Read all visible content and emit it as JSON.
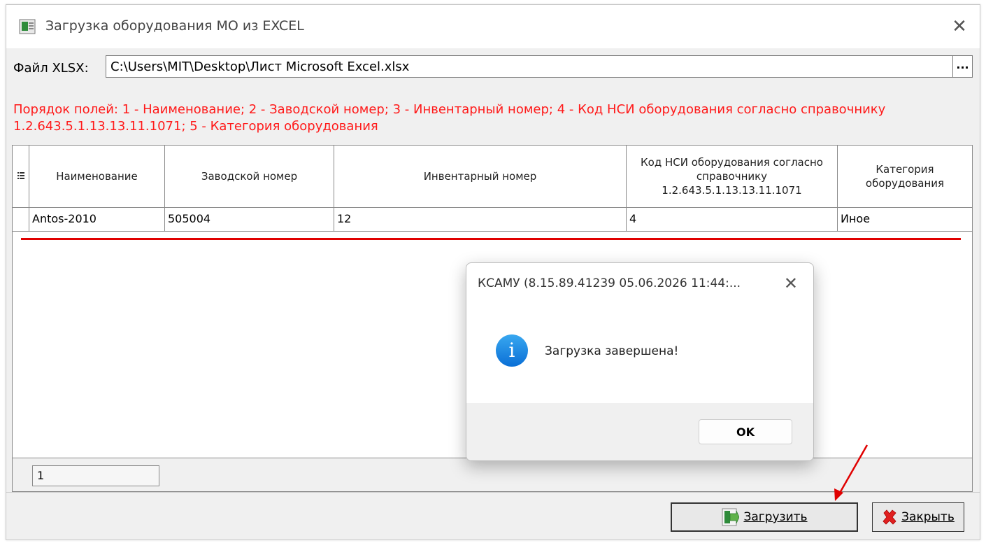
{
  "window": {
    "title": "Загрузка оборудования МО из EXCEL",
    "close_glyph": "✕"
  },
  "file": {
    "label": "Файл XLSX:",
    "value": "C:\\Users\\MIT\\Desktop\\Лист Microsoft Excel.xlsx",
    "browse_label": "..."
  },
  "order_note": "Порядок полей: 1 - Наименование; 2 - Заводской номер; 3 - Инвентарный номер; 4 - Код НСИ оборудования согласно справочнику 1.2.643.5.1.13.13.11.1071; 5 - Категория оборудования",
  "grid": {
    "columns": [
      "Наименование",
      "Заводской номер",
      "Инвентарный номер",
      "Код НСИ оборудования согласно справочнику 1.2.643.5.1.13.13.11.1071",
      "Категория оборудования"
    ],
    "rows": [
      [
        "Antos-2010",
        "505004",
        "12",
        "4",
        "Иное"
      ]
    ],
    "record_count": "1"
  },
  "buttons": {
    "load_label": "Загрузить",
    "close_label": "Закрыть"
  },
  "dialog": {
    "title": "КСАМУ (8.15.89.41239 05.06.2026 11:44:...",
    "close_glyph": "✕",
    "message": "Загрузка завершена!",
    "ok_label": "OK",
    "icon": "info-icon"
  },
  "colors": {
    "note_red": "#ff1a1a",
    "annotation_red": "#e00000",
    "info_blue": "#0a6fd6"
  }
}
